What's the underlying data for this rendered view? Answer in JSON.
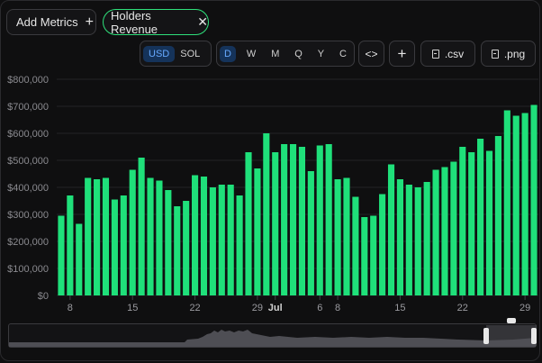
{
  "toolbar": {
    "add_metrics_label": "Add Metrics",
    "add_icon": "plus-icon",
    "metric_chip_label": "Holders Revenue",
    "close_icon": "close-icon"
  },
  "currency": {
    "options": [
      "USD",
      "SOL"
    ],
    "selected": "USD"
  },
  "timeframe": {
    "options": [
      "D",
      "W",
      "M",
      "Q",
      "Y",
      "C"
    ],
    "selected": "D"
  },
  "actions": {
    "code_icon": "code-icon",
    "add_icon": "plus-icon",
    "csv_label": ".csv",
    "png_label": ".png",
    "file_icon": "file-export-icon"
  },
  "chart_data": {
    "type": "bar",
    "title": "",
    "xlabel": "",
    "ylabel": "",
    "ylim": [
      0,
      800000
    ],
    "y_ticks": [
      "$0",
      "$100,000",
      "$200,000",
      "$300,000",
      "$400,000",
      "$500,000",
      "$600,000",
      "$700,000",
      "$800,000"
    ],
    "x_tick_labels": [
      {
        "index": 1,
        "label": "8"
      },
      {
        "index": 8,
        "label": "15"
      },
      {
        "index": 15,
        "label": "22"
      },
      {
        "index": 22,
        "label": "29"
      },
      {
        "index": 24,
        "label": "Jul"
      },
      {
        "index": 29,
        "label": "6"
      },
      {
        "index": 31,
        "label": "8"
      },
      {
        "index": 38,
        "label": "15"
      },
      {
        "index": 45,
        "label": "22"
      },
      {
        "index": 52,
        "label": "29"
      }
    ],
    "bold_tick": "Jul",
    "color": "#1fe07a",
    "series": [
      {
        "values": [
          295000,
          370000,
          265000,
          435000,
          430000,
          435000,
          355000,
          370000,
          465000,
          510000,
          435000,
          425000,
          390000,
          330000,
          350000,
          445000,
          440000,
          400000,
          410000,
          410000,
          370000,
          530000,
          470000,
          600000,
          530000,
          560000,
          560000,
          550000,
          460000,
          555000,
          560000,
          430000,
          435000,
          365000,
          290000,
          295000,
          375000,
          485000,
          430000,
          410000,
          400000,
          420000,
          465000,
          475000,
          495000,
          550000,
          530000,
          580000,
          535000,
          590000,
          685000,
          665000,
          675000,
          705000
        ]
      }
    ]
  },
  "navigator": {
    "selection_label": "range-brush"
  }
}
